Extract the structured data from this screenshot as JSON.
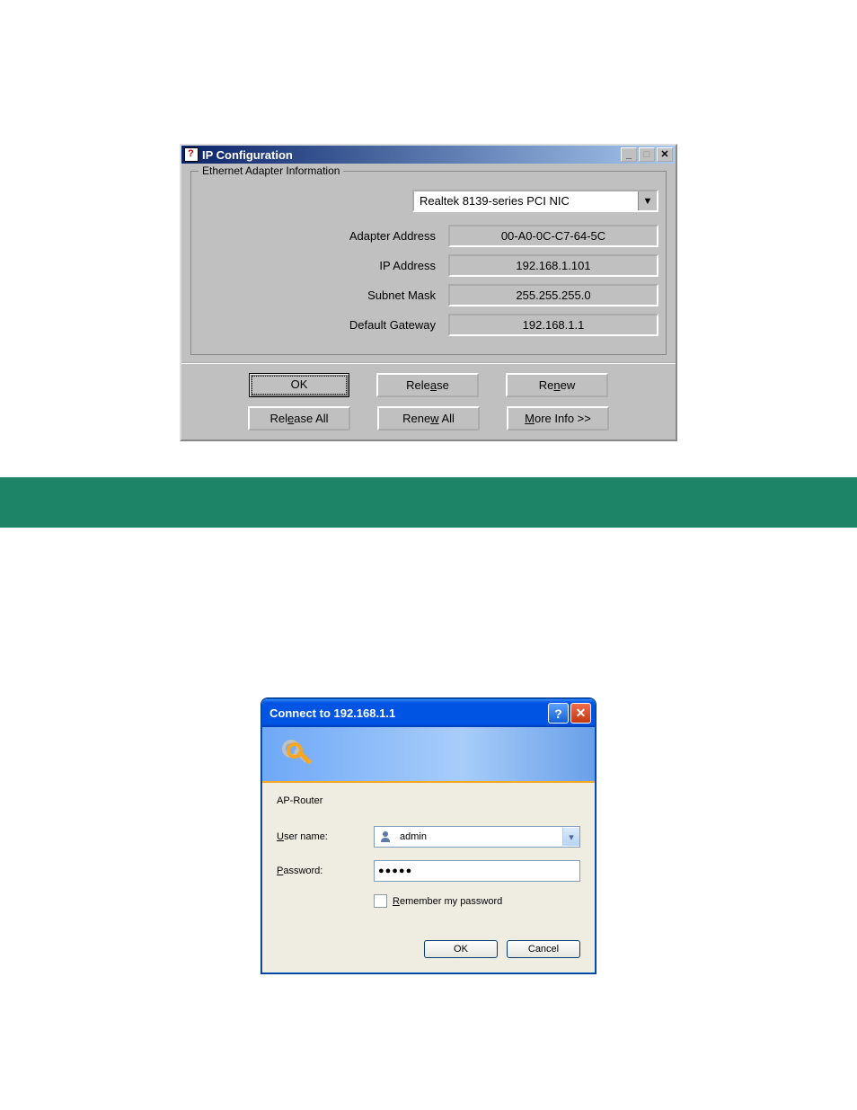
{
  "ipconfig": {
    "title": "IP Configuration",
    "groupLabel": "Ethernet  Adapter Information",
    "adapter": "Realtek 8139-series PCI NIC",
    "labels": {
      "adapterAddress": "Adapter Address",
      "ipAddress": "IP Address",
      "subnetMask": "Subnet Mask",
      "defaultGateway": "Default Gateway"
    },
    "values": {
      "adapterAddress": "00-A0-0C-C7-64-5C",
      "ipAddress": "192.168.1.101",
      "subnetMask": "255.255.255.0",
      "defaultGateway": "192.168.1.1"
    },
    "buttons": {
      "ok": "OK",
      "release_pre": "Rele",
      "release_u": "a",
      "release_post": "se",
      "renew_pre": "Re",
      "renew_u": "n",
      "renew_post": "ew",
      "releaseAll_pre": "Rel",
      "releaseAll_u": "e",
      "releaseAll_post": "ase All",
      "renewAll_pre": "Rene",
      "renewAll_u": "w",
      "renewAll_post": " All",
      "moreInfo_u": "M",
      "moreInfo_post": "ore Info >>"
    }
  },
  "login": {
    "title": "Connect to 192.168.1.1",
    "realm": "AP-Router",
    "labels": {
      "username_u": "U",
      "username_post": "ser name:",
      "password_u": "P",
      "password_post": "assword:",
      "remember_u": "R",
      "remember_post": "emember my password"
    },
    "values": {
      "username": " admin",
      "password": "●●●●●"
    },
    "buttons": {
      "ok": "OK",
      "cancel": "Cancel"
    }
  }
}
